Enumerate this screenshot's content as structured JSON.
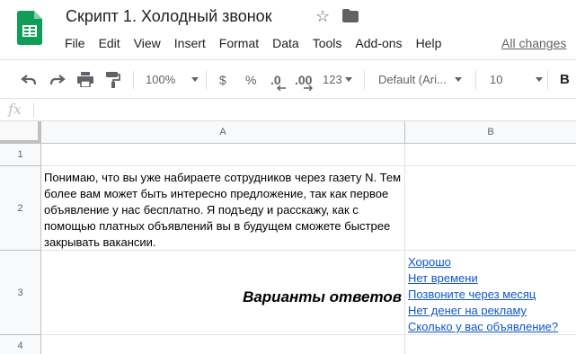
{
  "doc": {
    "title": "Скрипт 1. Холодный звонок"
  },
  "menu": {
    "items": [
      "File",
      "Edit",
      "View",
      "Insert",
      "Format",
      "Data",
      "Tools",
      "Add-ons",
      "Help"
    ],
    "changes": "All changes"
  },
  "toolbar": {
    "zoom": "100%",
    "currency": "$",
    "percent": "%",
    "decrease_decimals": ".0",
    "increase_decimals": ".00",
    "more_formats": "123",
    "font": "Default (Ari...",
    "font_size": "10",
    "bold": "B"
  },
  "formula": {
    "fx": "fx",
    "value": ""
  },
  "sheet": {
    "columns": [
      "A",
      "B"
    ],
    "rows": [
      "1",
      "2",
      "3",
      "4"
    ],
    "cells": {
      "A2": "Понимаю, что вы уже набираете сотрудников через газету N. Тем более вам может быть интересно предложение, так как первое объявление у нас бесплатно. Я подъеду и расскажу, как с помощью платных объявлений вы в будущем сможете быстрее закрывать вакансии.",
      "A3": "Варианты ответов",
      "B3": [
        "Хорошо",
        "Нет времени",
        "Позвоните через месяц",
        "Нет денег на рекламу",
        "Сколько у вас объявление?"
      ]
    }
  },
  "colors": {
    "sheets_green": "#0f9d58",
    "link": "#1155cc"
  }
}
